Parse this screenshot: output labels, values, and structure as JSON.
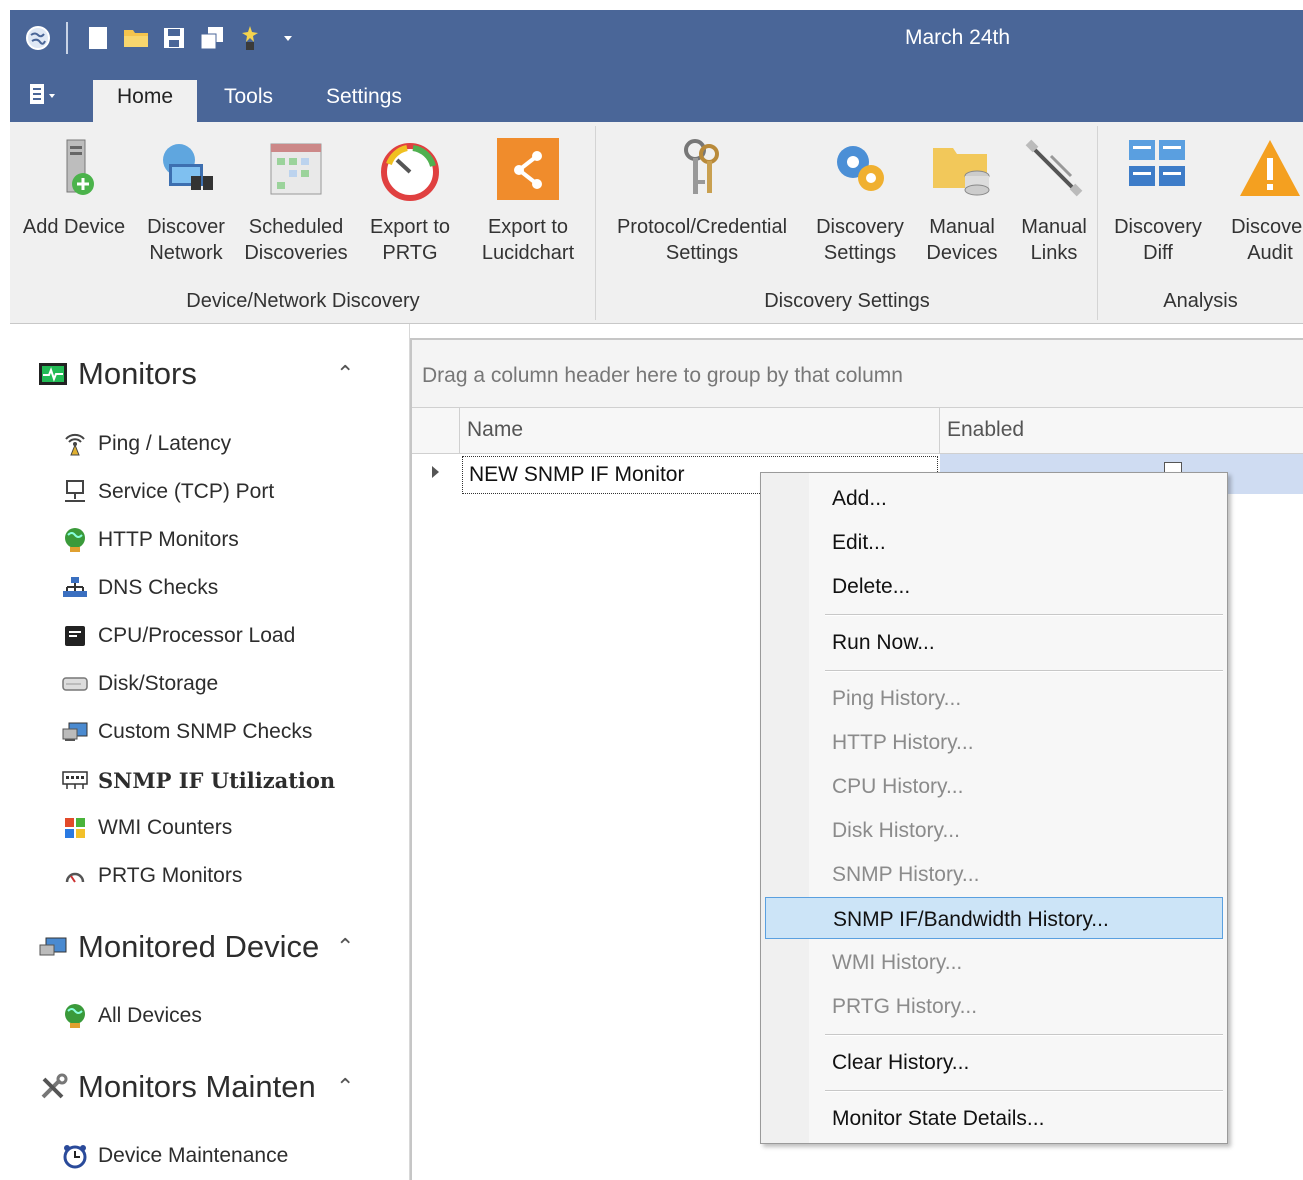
{
  "window": {
    "title": "March 24th"
  },
  "quick_access": {
    "icons": [
      "globe-icon",
      "new-document-icon",
      "open-folder-icon",
      "save-icon",
      "save-all-icon",
      "wizard-icon",
      "customize-dropdown-icon"
    ]
  },
  "ribbon_tabs": [
    {
      "label": "Home",
      "active": true
    },
    {
      "label": "Tools",
      "active": false
    },
    {
      "label": "Settings",
      "active": false
    }
  ],
  "ribbon": {
    "groups": [
      {
        "label": "Device/Network Discovery",
        "buttons": [
          {
            "label": "Add Device",
            "icon": "server-add-icon"
          },
          {
            "label": "Discover\nNetwork",
            "icon": "binoculars-computer-icon"
          },
          {
            "label": "Scheduled\nDiscoveries",
            "icon": "calendar-icon"
          },
          {
            "label": "Export to\nPRTG",
            "icon": "gauge-icon"
          },
          {
            "label": "Export to\nLucidchart",
            "icon": "share-icon"
          }
        ]
      },
      {
        "label": "Discovery Settings",
        "buttons": [
          {
            "label": "Protocol/Credential\nSettings",
            "icon": "keys-icon"
          },
          {
            "label": "Discovery\nSettings",
            "icon": "gears-icon"
          },
          {
            "label": "Manual\nDevices",
            "icon": "folder-database-icon"
          },
          {
            "label": "Manual\nLinks",
            "icon": "cable-icon"
          }
        ]
      },
      {
        "label": "Analysis",
        "buttons": [
          {
            "label": "Discovery\nDiff",
            "icon": "diff-icon"
          },
          {
            "label": "Discover\nAudit",
            "icon": "warning-icon"
          }
        ]
      }
    ]
  },
  "nav": {
    "sections": [
      {
        "title": "Monitors",
        "icon": "monitor-icon",
        "items": [
          {
            "label": "Ping / Latency",
            "icon": "antenna-icon"
          },
          {
            "label": "Service (TCP) Port",
            "icon": "network-port-icon"
          },
          {
            "label": "HTTP Monitors",
            "icon": "globe-user-icon"
          },
          {
            "label": "DNS Checks",
            "icon": "dns-tree-icon"
          },
          {
            "label": "CPU/Processor Load",
            "icon": "cpu-icon"
          },
          {
            "label": "Disk/Storage",
            "icon": "disk-icon"
          },
          {
            "label": "Custom SNMP Checks",
            "icon": "snmp-check-icon"
          },
          {
            "label": "SNMP IF Utilization",
            "icon": "switch-icon",
            "selected": true
          },
          {
            "label": "WMI Counters",
            "icon": "windows-icon"
          },
          {
            "label": "PRTG Monitors",
            "icon": "prtg-icon"
          }
        ]
      },
      {
        "title": "Monitored Device",
        "icon": "monitored-device-icon",
        "items": [
          {
            "label": "All Devices",
            "icon": "globe-user-icon"
          }
        ]
      },
      {
        "title": "Monitors Mainten",
        "icon": "tools-icon",
        "items": [
          {
            "label": "Device Maintenance",
            "icon": "alarm-clock-icon"
          }
        ]
      }
    ]
  },
  "grid": {
    "group_panel_text": "Drag a column header here to group by that column",
    "columns": [
      "Name",
      "Enabled"
    ],
    "rows": [
      {
        "name": "NEW SNMP IF Monitor",
        "enabled": true
      }
    ]
  },
  "context_menu": {
    "items": [
      {
        "label": "Add...",
        "enabled": true
      },
      {
        "label": "Edit...",
        "enabled": true
      },
      {
        "label": "Delete...",
        "enabled": true
      },
      {
        "separator": true
      },
      {
        "label": "Run Now...",
        "enabled": true
      },
      {
        "separator": true
      },
      {
        "label": "Ping History...",
        "enabled": false
      },
      {
        "label": "HTTP History...",
        "enabled": false
      },
      {
        "label": "CPU History...",
        "enabled": false
      },
      {
        "label": "Disk History...",
        "enabled": false
      },
      {
        "label": "SNMP History...",
        "enabled": false
      },
      {
        "label": "SNMP IF/Bandwidth History...",
        "enabled": true,
        "highlighted": true
      },
      {
        "label": "WMI History...",
        "enabled": false
      },
      {
        "label": "PRTG History...",
        "enabled": false
      },
      {
        "separator": true
      },
      {
        "label": "Clear History...",
        "enabled": true
      },
      {
        "separator": true
      },
      {
        "label": "Monitor State Details...",
        "enabled": true
      }
    ]
  },
  "colors": {
    "titlebar": "#4a6698",
    "ribbon": "#f0f0f0",
    "selection": "#cfdcf2",
    "menu_highlight": "#cce4f7",
    "menu_highlight_border": "#5aa0e0"
  }
}
